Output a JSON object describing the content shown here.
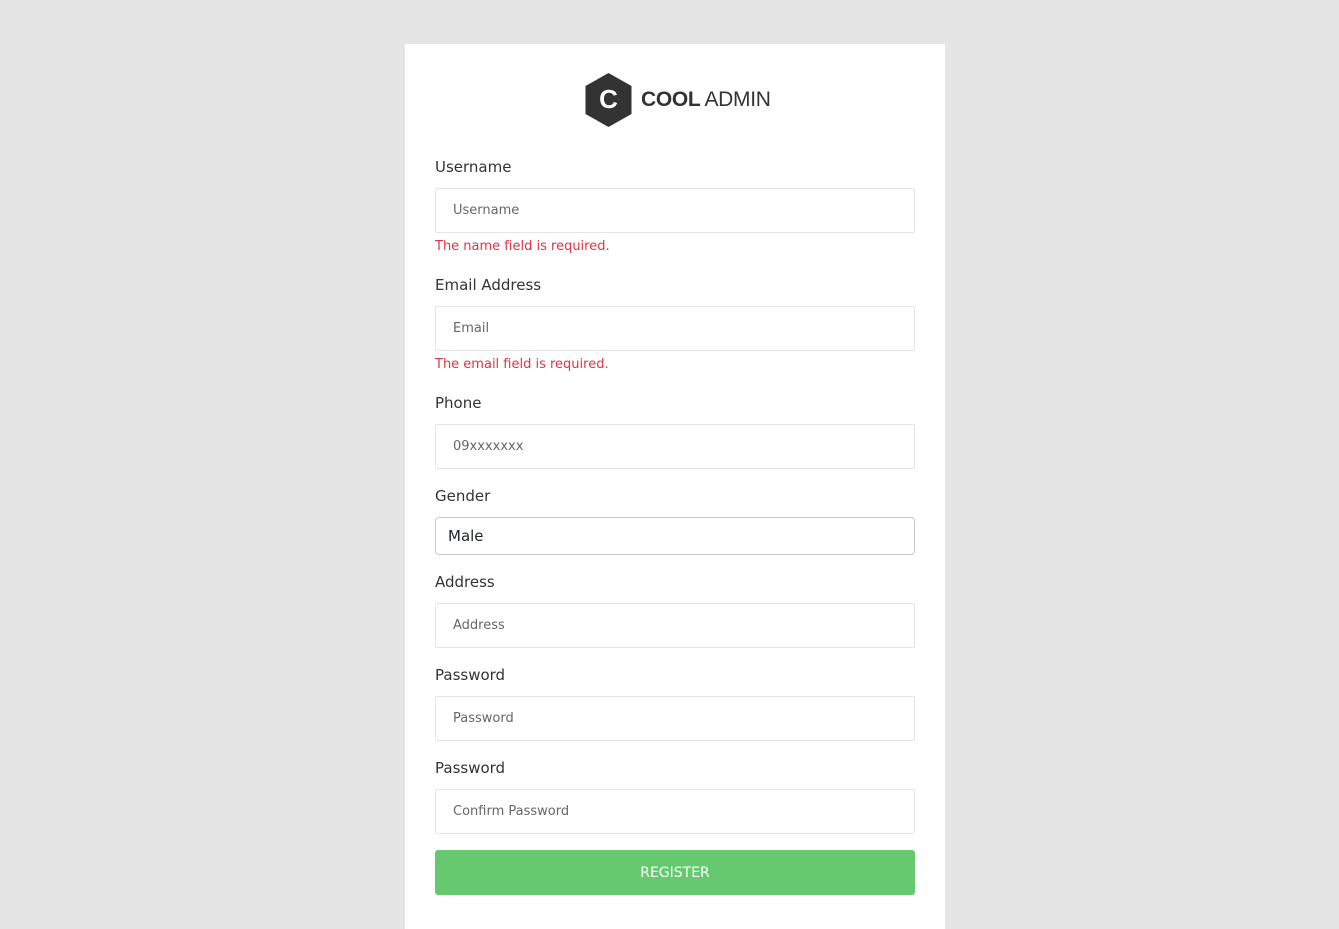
{
  "brand": {
    "logo_letter": "C",
    "name_bold": "COOL",
    "name_regular": "ADMIN"
  },
  "form": {
    "username": {
      "label": "Username",
      "placeholder": "Username",
      "value": "",
      "error": "The name field is required."
    },
    "email": {
      "label": "Email Address",
      "placeholder": "Email",
      "value": "",
      "error": "The email field is required."
    },
    "phone": {
      "label": "Phone",
      "placeholder": "09xxxxxxx",
      "value": ""
    },
    "gender": {
      "label": "Gender",
      "selected": "Male"
    },
    "address": {
      "label": "Address",
      "placeholder": "Address",
      "value": ""
    },
    "password": {
      "label": "Password",
      "placeholder": "Password",
      "value": ""
    },
    "confirm_password": {
      "label": "Password",
      "placeholder": "Confirm Password",
      "value": ""
    },
    "submit_label": "REGISTER"
  },
  "colors": {
    "background": "#e5e5e5",
    "card": "#ffffff",
    "error": "#dc3545",
    "button": "#66c970",
    "logo": "#333333"
  }
}
